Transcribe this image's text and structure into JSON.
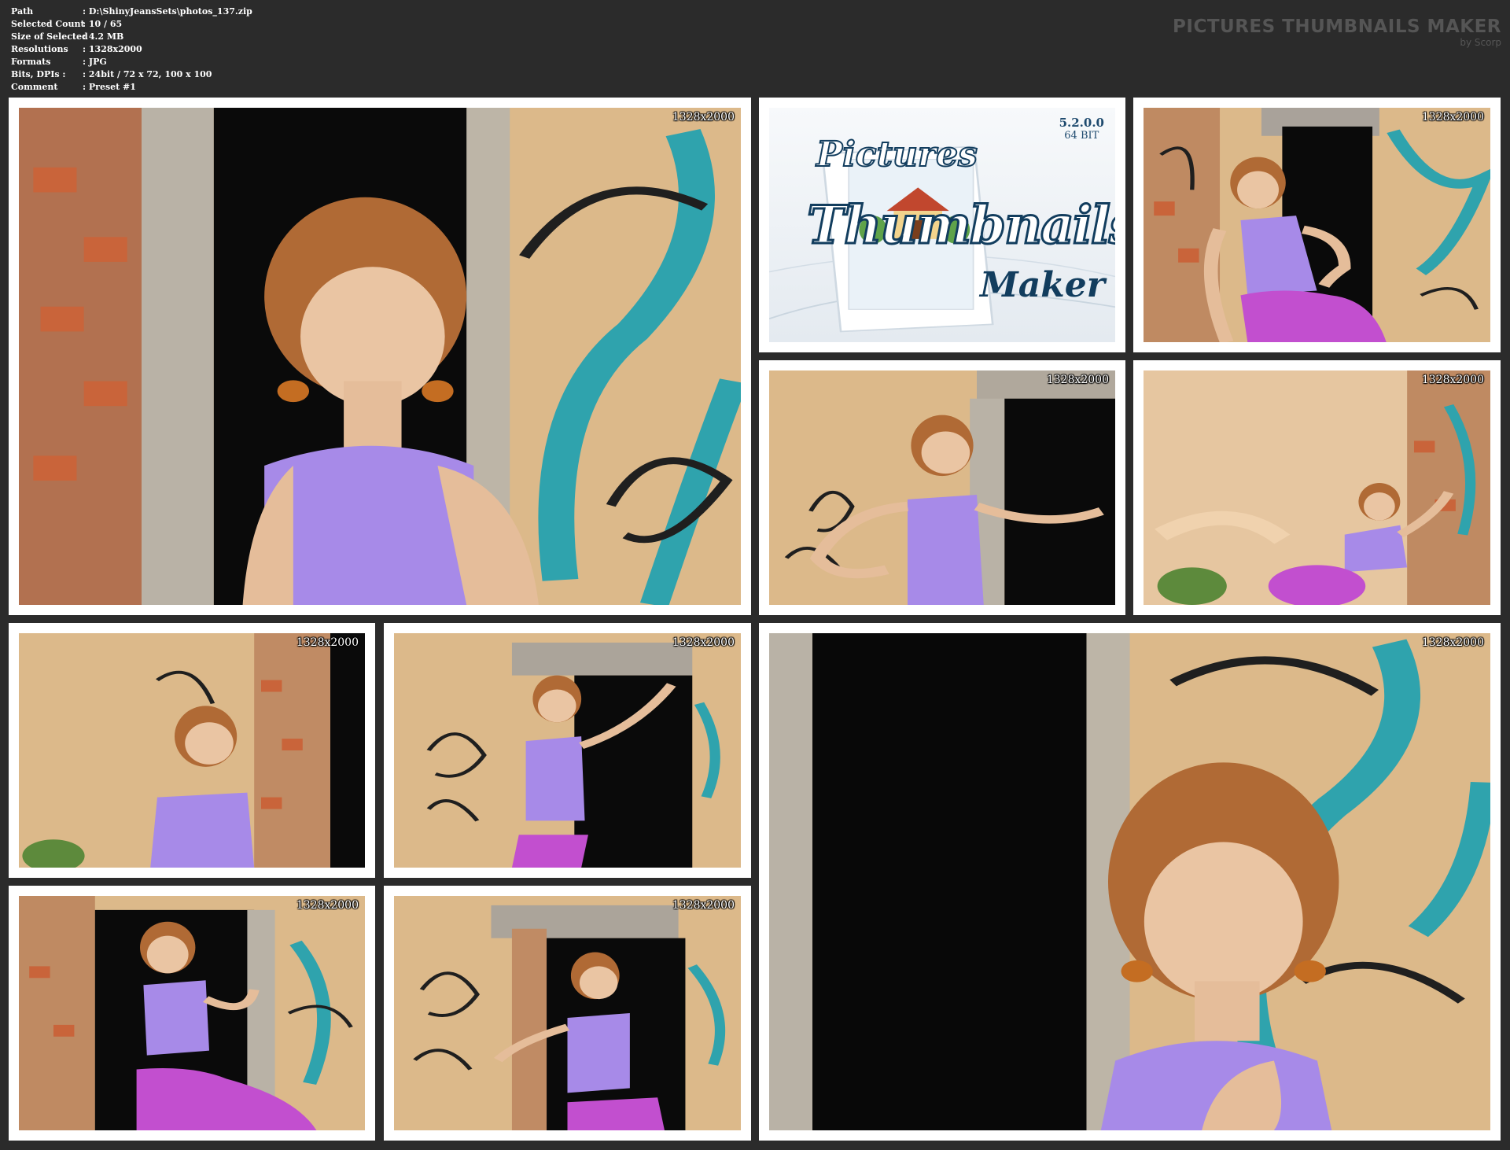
{
  "header": {
    "info_rows": [
      {
        "key": "Path",
        "value": "D:\\ShinyJeansSets\\photos_137.zip"
      },
      {
        "key": "Selected Count",
        "value": "10 / 65"
      },
      {
        "key": "Size of Selected",
        "value": "4.2 MB"
      },
      {
        "key": "Resolutions",
        "value": "1328x2000"
      },
      {
        "key": "Formats",
        "value": "JPG"
      },
      {
        "key": "Bits, DPIs :",
        "value": "24bit / 72 x 72, 100 x 100"
      },
      {
        "key": "Comment",
        "value": "Preset #1"
      }
    ],
    "brand_title": "PICTURES THUMBNAILS MAKER",
    "brand_subtitle": "by Scorp"
  },
  "logo": {
    "version": "5.2.0.0",
    "bitness": "64 BIT",
    "word1": "Pictures",
    "word2": "Thumbnails",
    "word3": "Maker"
  },
  "thumbnails": [
    {
      "resolution": "1328x2000"
    },
    {
      "resolution": "1328x2000"
    },
    {
      "resolution": "1328x2000"
    },
    {
      "resolution": "1328x2000"
    },
    {
      "resolution": "1328x2000"
    },
    {
      "resolution": "1328x2000"
    },
    {
      "resolution": "1328x2000"
    },
    {
      "resolution": "1328x2000"
    },
    {
      "resolution": "1328x2000"
    }
  ],
  "colors": {
    "background": "#2b2b2b",
    "tile_border": "#ffffff",
    "wall": "#dcb98a",
    "graffiti_teal": "#2fa3ad",
    "top_purple": "#a78ae8",
    "pants_magenta": "#c24fcf",
    "hair": "#b06a35"
  }
}
